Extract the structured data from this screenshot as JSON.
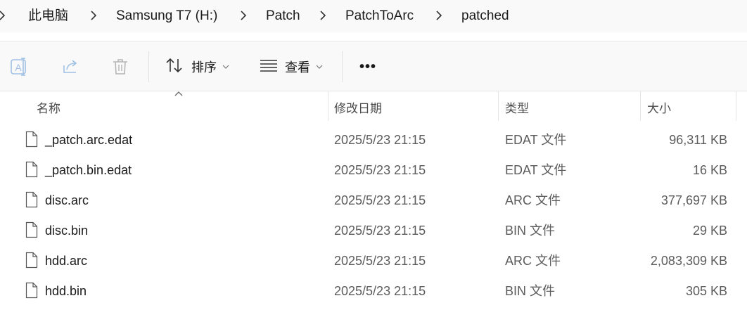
{
  "breadcrumb": {
    "items": [
      "此电脑",
      "Samsung T7 (H:)",
      "Patch",
      "PatchToArc",
      "patched"
    ]
  },
  "toolbar": {
    "icons": [
      "rename-icon",
      "share-icon",
      "delete-icon"
    ],
    "sort_label": "排序",
    "view_label": "查看",
    "more_label": "•••"
  },
  "columns": {
    "name": "名称",
    "date": "修改日期",
    "type": "类型",
    "size": "大小"
  },
  "files": [
    {
      "name": "_patch.arc.edat",
      "date": "2025/5/23 21:15",
      "type": "EDAT 文件",
      "size": "96,311 KB"
    },
    {
      "name": "_patch.bin.edat",
      "date": "2025/5/23 21:15",
      "type": "EDAT 文件",
      "size": "16 KB"
    },
    {
      "name": "disc.arc",
      "date": "2025/5/23 21:15",
      "type": "ARC 文件",
      "size": "377,697 KB"
    },
    {
      "name": "disc.bin",
      "date": "2025/5/23 21:15",
      "type": "BIN 文件",
      "size": "29 KB"
    },
    {
      "name": "hdd.arc",
      "date": "2025/5/23 21:15",
      "type": "ARC 文件",
      "size": "2,083,309 KB"
    },
    {
      "name": "hdd.bin",
      "date": "2025/5/23 21:15",
      "type": "BIN 文件",
      "size": "305 KB"
    }
  ]
}
